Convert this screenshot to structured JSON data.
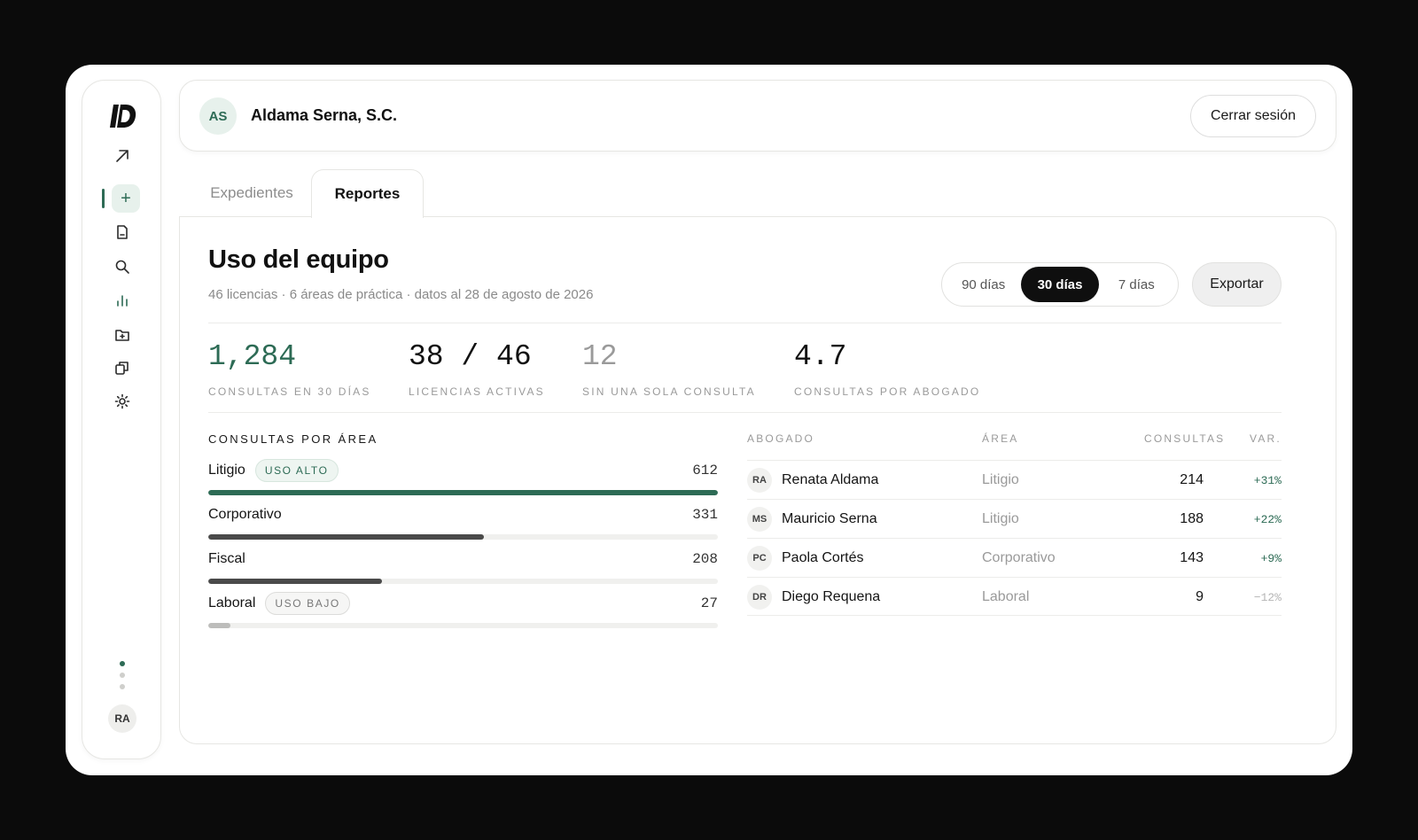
{
  "colors": {
    "accent": "#2d6b55",
    "accent_soft": "#e7f1ec",
    "bar_dark": "#4a4a4a",
    "bar_light": "#bdbdbb",
    "negative": "#b5b5b5"
  },
  "sidebar": {
    "icons": [
      "logo-icon",
      "arrow-up-right-icon",
      "plus-icon",
      "document-icon",
      "search-icon",
      "bar-chart-icon",
      "folder-icon",
      "copy-icon",
      "gear-icon"
    ],
    "user_initials": "RA"
  },
  "header": {
    "org_initials": "AS",
    "org_name": "Aldama Serna, S.C.",
    "logout_label": "Cerrar sesión"
  },
  "tabs": [
    {
      "label": "Expedientes",
      "active": false
    },
    {
      "label": "Reportes",
      "active": true
    }
  ],
  "report": {
    "title": "Uso del equipo",
    "subtitle": "46 licencias · 6 áreas de práctica · datos al 28 de agosto de 2026",
    "ranges": [
      {
        "label": "90 días",
        "selected": false
      },
      {
        "label": "30 días",
        "selected": true
      },
      {
        "label": "7 días",
        "selected": false
      }
    ],
    "export_label": "Exportar",
    "kpis": [
      {
        "value": "1,284",
        "label": "CONSULTAS EN 30 DÍAS"
      },
      {
        "value": "38 / 46",
        "label": "LICENCIAS ACTIVAS"
      },
      {
        "value": "12",
        "label": "SIN UNA SOLA CONSULTA"
      },
      {
        "value": "4.7",
        "label": "CONSULTAS POR ABOGADO"
      }
    ],
    "areas_title": "CONSULTAS POR ÁREA",
    "areas": [
      {
        "name": "Litigio",
        "badge": "USO ALTO",
        "count": "612",
        "fraction": 1.0
      },
      {
        "name": "Corporativo",
        "badge": "",
        "count": "331",
        "fraction": 0.541
      },
      {
        "name": "Fiscal",
        "badge": "",
        "count": "208",
        "fraction": 0.34
      },
      {
        "name": "Laboral",
        "badge": "USO BAJO",
        "count": "27",
        "fraction": 0.044
      }
    ],
    "table": {
      "headers": [
        "ABOGADO",
        "ÁREA",
        "CONSULTAS",
        "VAR."
      ],
      "rows": [
        {
          "initials": "RA",
          "name": "Renata Aldama",
          "area": "Litigio",
          "consultas": "214",
          "var": "+31%"
        },
        {
          "initials": "MS",
          "name": "Mauricio Serna",
          "area": "Litigio",
          "consultas": "188",
          "var": "+22%"
        },
        {
          "initials": "PC",
          "name": "Paola Cortés",
          "area": "Corporativo",
          "consultas": "143",
          "var": "+9%"
        },
        {
          "initials": "DR",
          "name": "Diego Requena",
          "area": "Laboral",
          "consultas": "9",
          "var": "−12%"
        }
      ]
    }
  }
}
